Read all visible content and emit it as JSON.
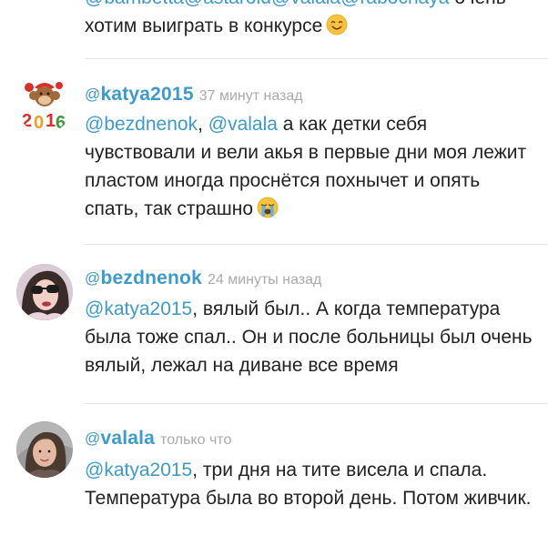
{
  "partial_comment": {
    "line1_mentions": "@bambetta@astaroid@valala@rabochaya",
    "line1_text": " очень",
    "line2_text": "хотим выиграть в конкурсе",
    "emoji": "smiling-face-emoji"
  },
  "comments": [
    {
      "at": "@",
      "username": "katya2015",
      "time": "37 минут назад",
      "mention1": "@bezdnenok",
      "sep": ", ",
      "mention2": "@valala",
      "text": " а как детки себя чувствовали и вели акья в первые дни моя лежит пластом иногда проснётся похнычет и опять спать, так страшно",
      "emoji": "loudly-crying-face-emoji"
    },
    {
      "at": "@",
      "username": "bezdnenok",
      "time": "24 минуты назад",
      "mention1": "@katya2015",
      "text": ", вялый был.. А когда температура была тоже спал.. Он и после больницы был очень вялый, лежал на диване все время"
    },
    {
      "at": "@",
      "username": "valala",
      "time": "только что",
      "mention1": "@katya2015",
      "text": ", три дня на тите висела и спала. Температура была во второй день. Потом живчик."
    }
  ],
  "colors": {
    "mention": "#3e9bc9",
    "text": "#222222",
    "timestamp": "#aaaaaa",
    "divider": "#e3e3e3"
  }
}
